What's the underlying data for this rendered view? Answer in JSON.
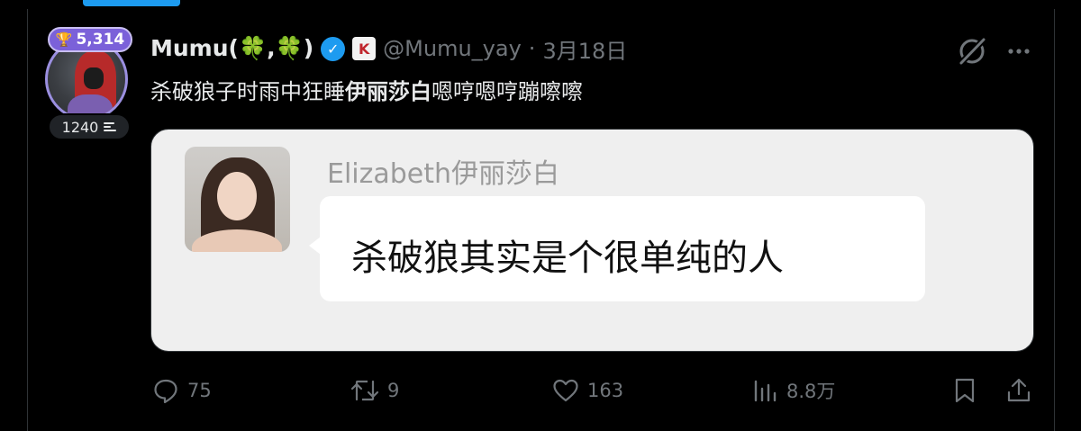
{
  "tweet": {
    "author": {
      "display_name": "Mumu(",
      "clover": "🍀",
      "comma": ",",
      "close": ")",
      "handle": "@Mumu_yay",
      "separator": "·",
      "date": "3月18日",
      "score_badge": "5,314",
      "level_count": "1240",
      "verified": true
    },
    "text_before": "杀破狼子时雨中狂睡",
    "text_bold": "伊丽莎白",
    "text_after": "嗯哼嗯哼蹦嚓嚓",
    "media": {
      "quoted_name": "Elizabeth伊丽莎白",
      "quoted_message": "杀破狼其实是个很单纯的人"
    },
    "actions": {
      "reply_count": "75",
      "retweet_count": "9",
      "like_count": "163",
      "view_count": "8.8万"
    }
  },
  "colors": {
    "background": "#000000",
    "accent": "#1d9bf0",
    "badge_purple": "#7b61d9",
    "muted_text": "#71767b",
    "primary_text": "#e7e9ea"
  },
  "icons": {
    "trophy": "trophy-icon",
    "verified": "verified-icon",
    "k": "k-badge-icon",
    "grok": "grok-icon",
    "more": "more-icon",
    "reply": "reply-icon",
    "retweet": "retweet-icon",
    "like": "like-icon",
    "views": "views-icon",
    "bookmark": "bookmark-icon",
    "share": "share-icon"
  }
}
